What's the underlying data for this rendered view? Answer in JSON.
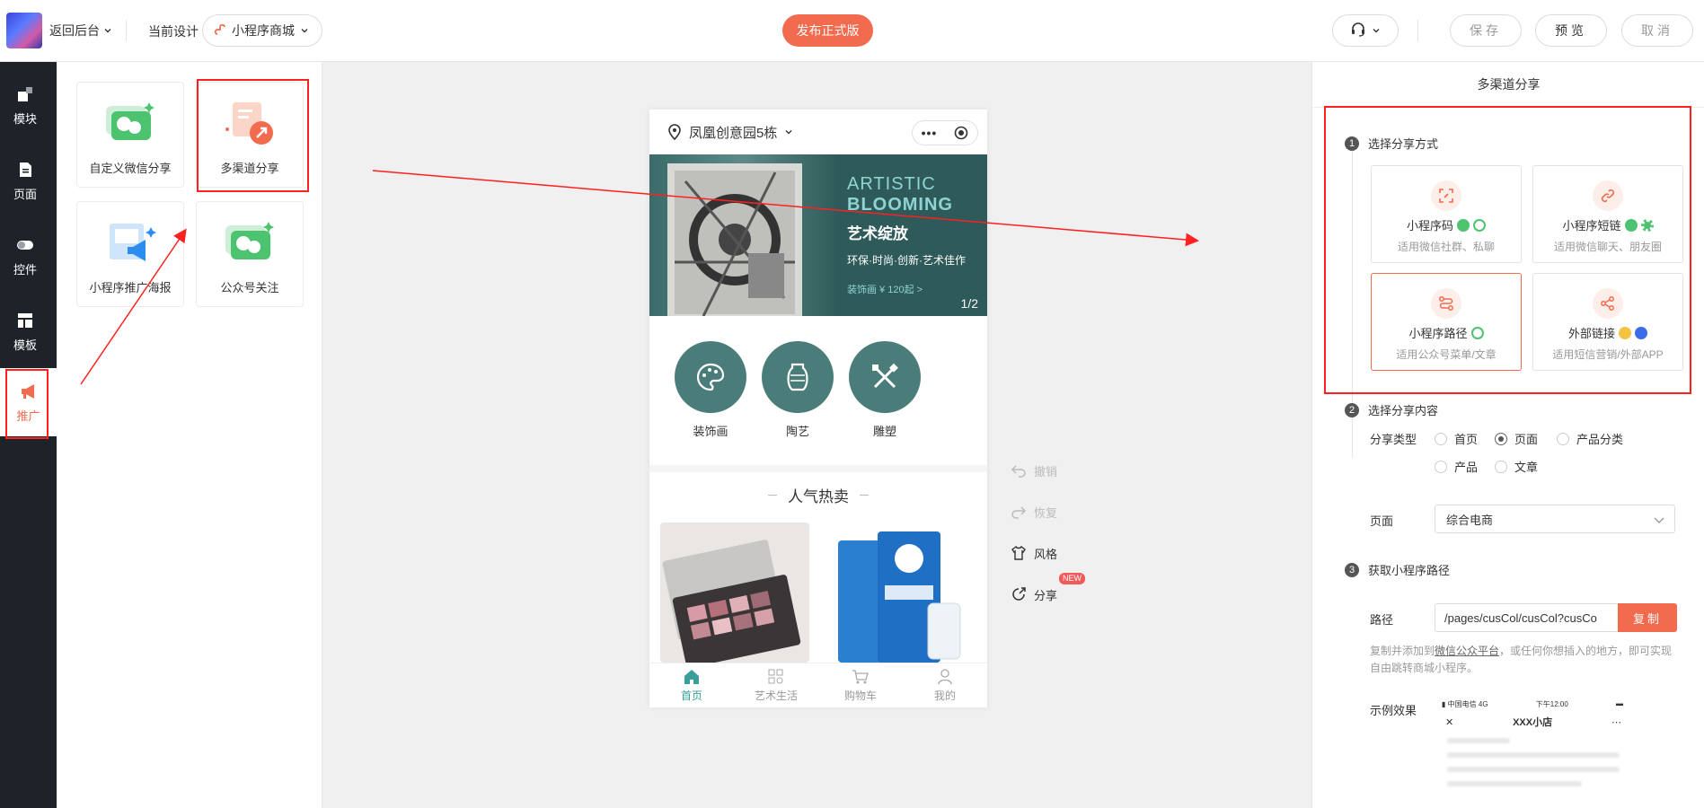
{
  "header": {
    "back_label": "返回后台",
    "current_design_label": "当前设计",
    "design_name": "小程序商城",
    "publish_label": "发布正式版",
    "save_label": "保存",
    "preview_label": "预览",
    "cancel_label": "取消"
  },
  "leftnav": {
    "items": [
      {
        "label": "模块",
        "icon": "modules-icon"
      },
      {
        "label": "页面",
        "icon": "page-icon"
      },
      {
        "label": "控件",
        "icon": "toggle-icon"
      },
      {
        "label": "模板",
        "icon": "template-icon"
      },
      {
        "label": "推广",
        "icon": "megaphone-icon"
      }
    ],
    "active": "推广"
  },
  "widgets": [
    {
      "label": "自定义微信分享"
    },
    {
      "label": "多渠道分享"
    },
    {
      "label": "小程序推广海报"
    },
    {
      "label": "公众号关注"
    }
  ],
  "phone": {
    "location": "凤凰创意园5栋",
    "banner": {
      "line1": "ARTISTIC",
      "line2": "BLOOMING",
      "title": "艺术绽放",
      "subtitle": "环保·时尚·创新·艺术佳作",
      "price": "装饰画 ¥ 120起 >",
      "pager": "1/2"
    },
    "categories": [
      "装饰画",
      "陶艺",
      "雕塑"
    ],
    "hot_title": "人气热卖",
    "tabs": [
      "首页",
      "艺术生活",
      "购物车",
      "我的"
    ]
  },
  "side_tools": {
    "undo": "撤销",
    "redo": "恢复",
    "style": "风格",
    "share": "分享",
    "new_badge": "NEW"
  },
  "rpanel": {
    "title": "多渠道分享",
    "step1": {
      "num": "1",
      "label": "选择分享方式"
    },
    "cards": [
      {
        "title": "小程序码",
        "desc": "适用微信社群、私聊"
      },
      {
        "title": "小程序短链",
        "desc": "适用微信聊天、朋友圈"
      },
      {
        "title": "小程序路径",
        "desc": "适用公众号菜单/文章"
      },
      {
        "title": "外部链接",
        "desc": "适用短信营销/外部APP"
      }
    ],
    "step2": {
      "num": "2",
      "label": "选择分享内容"
    },
    "share_type_label": "分享类型",
    "share_types": [
      "首页",
      "页面",
      "产品分类",
      "产品",
      "文章"
    ],
    "share_type_selected": "页面",
    "page_label": "页面",
    "page_value": "综合电商",
    "step3": {
      "num": "3",
      "label": "获取小程序路径"
    },
    "path_label": "路径",
    "path_value": "/pages/cusCol/cusCol?cusCo",
    "copy_label": "复制",
    "hint_pre": "复制并添加到",
    "hint_link": "微信公众平台",
    "hint_post": "，或任何你想插入的地方，即可实现自由跳转商城小程序。",
    "example_label": "示例效果",
    "mock": {
      "carrier": "中国电信",
      "network": "4G",
      "time": "下午12:00",
      "shop_name": "XXX小店"
    }
  },
  "colors": {
    "accent": "#f26b4e",
    "nav_bg": "#1e2329",
    "highlight": "#ff2020",
    "teal": "#4a7d7a"
  }
}
